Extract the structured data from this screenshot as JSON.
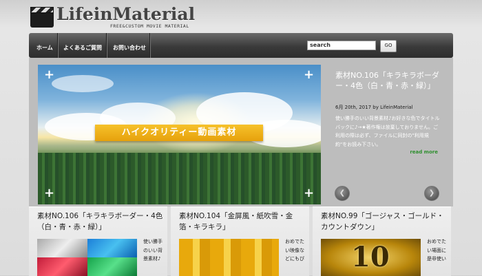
{
  "site": {
    "title": "LifeinMaterial",
    "subtitle": "FREE&CUSTOM MOVIE MATERIAL"
  },
  "nav": {
    "items": [
      {
        "label": "ホーム"
      },
      {
        "label": "よくあるご質問"
      },
      {
        "label": "お問い合わせ"
      }
    ],
    "search_value": "search",
    "go_label": "GO"
  },
  "slider": {
    "banner_text": "ハイクオリティー動画素材",
    "title": "素材NO.106「キラキラボーダー・4色（白・青・赤・緑）」",
    "meta": "6月 20th, 2017 by LifeinMaterial",
    "description": "使い勝手のいい背景素材♪お好きな色でタイトルバックに♪→★著作権は放棄しておりません。ご利用の際は必ず、ファイルに同封の\"利用規約\"をお読み下さい。",
    "read_more": "read more",
    "prev_label": "❮",
    "next_label": "❯"
  },
  "cards": [
    {
      "title": "素材NO.106「キラキラボーダー・4色（白・青・赤・緑）」",
      "text": "使い勝手のいい背景素材♪"
    },
    {
      "title": "素材NO.104「金屏風・紙吹雪・金箔・キラキラ」",
      "text": "おめでたい映像などにもぴ"
    },
    {
      "title": "素材NO.99「ゴージャス・ゴールド・カウントダウン」",
      "text": "おめでたい場面に是非使い",
      "thumb_number": "10"
    }
  ],
  "colors": {
    "nav_bg": "#3a3a3a",
    "banner": "#f0b41c",
    "read_more": "#2f8f2f"
  }
}
